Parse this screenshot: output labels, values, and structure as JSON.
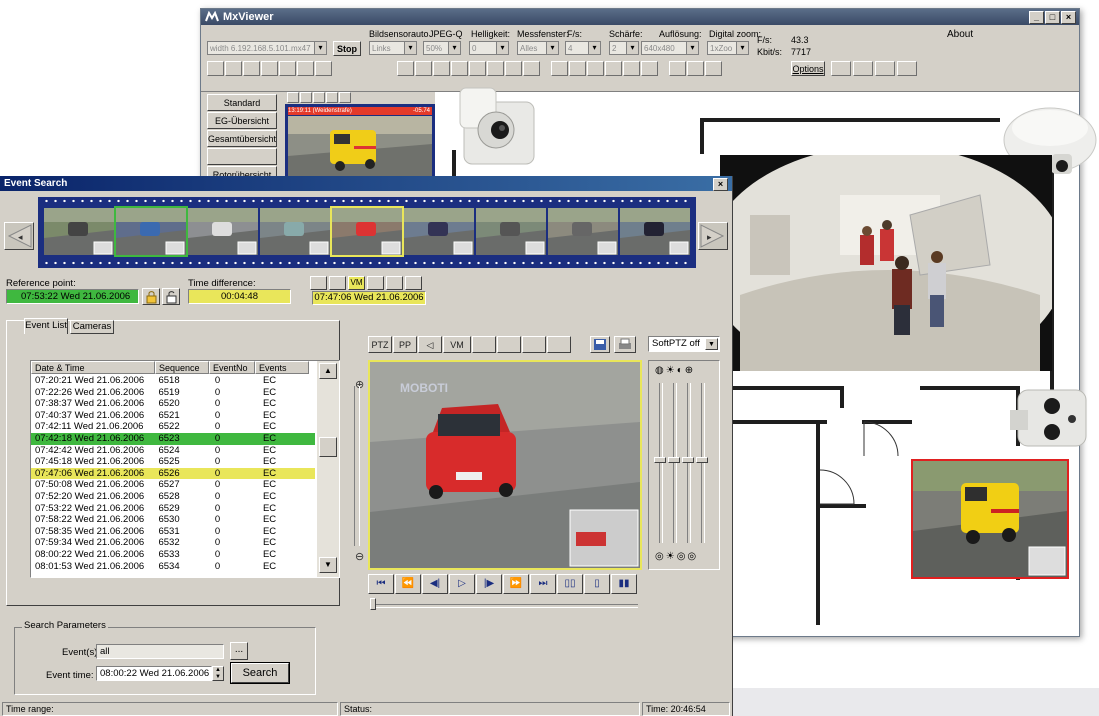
{
  "viewer": {
    "title": "MxViewer",
    "about": "About",
    "address": "width 6.192.168.5.101.mx47",
    "stop": "Stop",
    "labels": {
      "bildsensor": "Bildsensor",
      "auto": "auto",
      "jpeg": "JPEG-Q",
      "helligkeit": "Helligkeit:",
      "messfenster": "Messfenster:",
      "fs": "F/s:",
      "schaerfe": "Schärfe:",
      "aufloesung": "Auflösung:",
      "zoom": "Digital zoom:"
    },
    "combos": {
      "sensor": "Links",
      "jpeg": "50%",
      "helligkeit": "0",
      "messfenster": "Alles",
      "fs": "4",
      "schaerfe": "2",
      "aufloesung": "640x480",
      "zoom": "1xZoo"
    },
    "stats": {
      "fs_label": "F/s:",
      "fs_value": "43.3",
      "kbit_label": "Kbit/s:",
      "kbit_value": "7717"
    },
    "options": "Options",
    "sidebar": [
      "Standard",
      "EG-Übersicht",
      "Gesamtübersicht",
      "",
      "Rotorübersicht"
    ],
    "thumb_header": "13:19:11 (Weidenstrafe)",
    "thumb_right": "-05.74"
  },
  "es": {
    "title": "Event Search",
    "reference_label": "Reference point:",
    "reference_value": "07:53:22 Wed 21.06.2006",
    "diff_label": "Time difference:",
    "diff_value": "00:04:48",
    "vm": "VM",
    "event_time_value": "07:47:06 Wed 21.06.2006",
    "tabs": [
      "Event List",
      "Cameras"
    ],
    "columns": [
      "Date & Time",
      "Sequence",
      "EventNo",
      "Events"
    ],
    "rows": [
      {
        "t": "07:20:21 Wed 21.06.2006",
        "s": "6518",
        "n": "0",
        "e": "EC"
      },
      {
        "t": "07:22:26 Wed 21.06.2006",
        "s": "6519",
        "n": "0",
        "e": "EC"
      },
      {
        "t": "07:38:37 Wed 21.06.2006",
        "s": "6520",
        "n": "0",
        "e": "EC"
      },
      {
        "t": "07:40:37 Wed 21.06.2006",
        "s": "6521",
        "n": "0",
        "e": "EC"
      },
      {
        "t": "07:42:11 Wed 21.06.2006",
        "s": "6522",
        "n": "0",
        "e": "EC"
      },
      {
        "t": "07:42:18 Wed 21.06.2006",
        "s": "6523",
        "n": "0",
        "e": "EC"
      },
      {
        "t": "07:42:42 Wed 21.06.2006",
        "s": "6524",
        "n": "0",
        "e": "EC"
      },
      {
        "t": "07:45:18 Wed 21.06.2006",
        "s": "6525",
        "n": "0",
        "e": "EC"
      },
      {
        "t": "07:47:06 Wed 21.06.2006",
        "s": "6526",
        "n": "0",
        "e": "EC"
      },
      {
        "t": "07:50:08 Wed 21.06.2006",
        "s": "6527",
        "n": "0",
        "e": "EC"
      },
      {
        "t": "07:52:20 Wed 21.06.2006",
        "s": "6528",
        "n": "0",
        "e": "EC"
      },
      {
        "t": "07:53:22 Wed 21.06.2006",
        "s": "6529",
        "n": "0",
        "e": "EC"
      },
      {
        "t": "07:58:22 Wed 21.06.2006",
        "s": "6530",
        "n": "0",
        "e": "EC"
      },
      {
        "t": "07:58:35 Wed 21.06.2006",
        "s": "6531",
        "n": "0",
        "e": "EC"
      },
      {
        "t": "07:59:34 Wed 21.06.2006",
        "s": "6532",
        "n": "0",
        "e": "EC"
      },
      {
        "t": "08:00:22 Wed 21.06.2006",
        "s": "6533",
        "n": "0",
        "e": "EC"
      },
      {
        "t": "08:01:53 Wed 21.06.2006",
        "s": "6534",
        "n": "0",
        "e": "EC"
      }
    ],
    "selected_green": 5,
    "selected_yellow": 8,
    "colors": {
      "green": "#3fb83f",
      "yellow": "#e9e65a",
      "film": "#1b2e80"
    },
    "player_buttons": [
      "PTZ",
      "PP",
      "◁",
      "VM"
    ],
    "softptz": "SoftPTZ off",
    "playback": [
      "⏮",
      "⏪",
      "◀|",
      "▷",
      "|▶",
      "⏩",
      "⏭",
      "▯▯",
      "▯",
      "▮▮"
    ],
    "search_params_label": "Search Parameters",
    "events_label": "Event(s):",
    "events_value": "all",
    "browse": "...",
    "event_time_label": "Event time:",
    "search_time_value": "08:00:22 Wed 21.06.2006",
    "search_button": "Search",
    "status": {
      "time_range": "Time range:",
      "status": "Status:",
      "time": "Time: 20:46:54"
    },
    "watermark": "MOBOTI"
  }
}
